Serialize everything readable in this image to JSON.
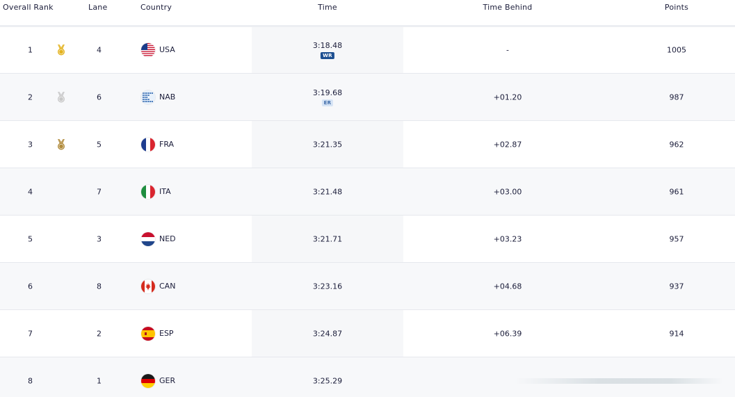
{
  "table": {
    "headers": {
      "rank": "Overall Rank",
      "lane": "Lane",
      "country": "Country",
      "time": "Time",
      "behind": "Time Behind",
      "points": "Points"
    },
    "rows": [
      {
        "rank": "1",
        "medal": "gold",
        "lane": "4",
        "country": "USA",
        "flag": "usa-flag-icon",
        "time": "3:18.48",
        "badge": "WR",
        "behind": "-",
        "points": "1005"
      },
      {
        "rank": "2",
        "medal": "silver",
        "lane": "6",
        "country": "NAB",
        "flag": "nab-flag-icon",
        "time": "3:19.68",
        "badge": "ER",
        "behind": "+01.20",
        "points": "987"
      },
      {
        "rank": "3",
        "medal": "bronze",
        "lane": "5",
        "country": "FRA",
        "flag": "fra-flag-icon",
        "time": "3:21.35",
        "badge": "",
        "behind": "+02.87",
        "points": "962"
      },
      {
        "rank": "4",
        "medal": "",
        "lane": "7",
        "country": "ITA",
        "flag": "ita-flag-icon",
        "time": "3:21.48",
        "badge": "",
        "behind": "+03.00",
        "points": "961"
      },
      {
        "rank": "5",
        "medal": "",
        "lane": "3",
        "country": "NED",
        "flag": "ned-flag-icon",
        "time": "3:21.71",
        "badge": "",
        "behind": "+03.23",
        "points": "957"
      },
      {
        "rank": "6",
        "medal": "",
        "lane": "8",
        "country": "CAN",
        "flag": "can-flag-icon",
        "time": "3:23.16",
        "badge": "",
        "behind": "+04.68",
        "points": "937"
      },
      {
        "rank": "7",
        "medal": "",
        "lane": "2",
        "country": "ESP",
        "flag": "esp-flag-icon",
        "time": "3:24.87",
        "badge": "",
        "behind": "+06.39",
        "points": "914"
      },
      {
        "rank": "8",
        "medal": "",
        "lane": "1",
        "country": "GER",
        "flag": "ger-flag-icon",
        "time": "3:25.29",
        "badge": "",
        "behind": "",
        "points": ""
      }
    ]
  },
  "colors": {
    "text": "#1b1d3a",
    "gold": "#e3b21d",
    "silver": "#c8c8c8",
    "bronze": "#b08a3a",
    "wr_badge": "#1d4f91",
    "er_badge": "#d6e4f5",
    "row_alt": "#f7f8fa",
    "time_column": "#f6f7f9"
  }
}
